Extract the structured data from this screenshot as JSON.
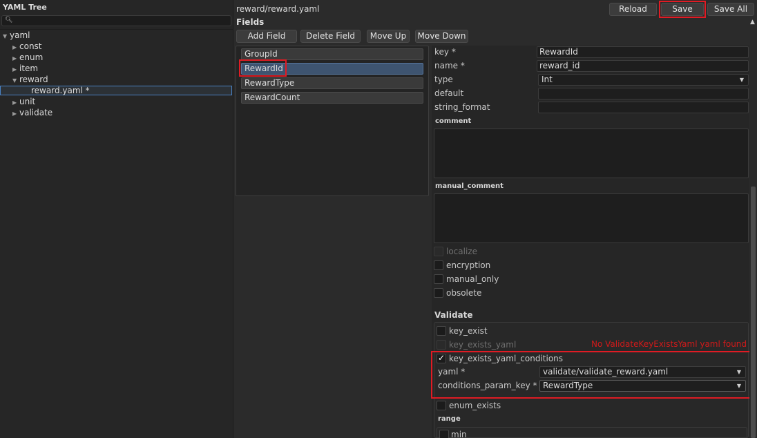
{
  "tree": {
    "title": "YAML Tree",
    "search_placeholder": "",
    "items": [
      {
        "label": "yaml",
        "expanded": true
      },
      {
        "label": "const",
        "expanded": false
      },
      {
        "label": "enum",
        "expanded": false
      },
      {
        "label": "item",
        "expanded": false
      },
      {
        "label": "reward",
        "expanded": true
      },
      {
        "label": "reward.yaml *",
        "selected": true
      },
      {
        "label": "unit",
        "expanded": false
      },
      {
        "label": "validate",
        "expanded": false
      }
    ]
  },
  "header": {
    "file_path": "reward/reward.yaml",
    "reload_label": "Reload",
    "save_label": "Save",
    "save_all_label": "Save All"
  },
  "fields": {
    "title": "Fields",
    "toolbar": {
      "add_label": "Add Field",
      "delete_label": "Delete Field",
      "move_up_label": "Move Up",
      "move_down_label": "Move Down"
    },
    "list": [
      "GroupId",
      "RewardId",
      "RewardType",
      "RewardCount"
    ],
    "selected": "RewardId"
  },
  "detail": {
    "key_label": "key *",
    "key_value": "RewardId",
    "name_label": "name *",
    "name_value": "reward_id",
    "type_label": "type",
    "type_value": "Int",
    "default_label": "default",
    "default_value": "",
    "string_format_label": "string_format",
    "string_format_value": "",
    "comment_label": "comment",
    "manual_comment_label": "manual_comment",
    "checkboxes": {
      "localize": {
        "label": "localize",
        "checked": false,
        "enabled": false
      },
      "encryption": {
        "label": "encryption",
        "checked": false
      },
      "manual_only": {
        "label": "manual_only",
        "checked": false
      },
      "obsolete": {
        "label": "obsolete",
        "checked": false
      }
    }
  },
  "validate": {
    "title": "Validate",
    "key_exist_label": "key_exist",
    "key_exists_yaml_label": "key_exists_yaml",
    "error_text": "No ValidateKeyExistsYaml yaml found",
    "conditions_label": "key_exists_yaml_conditions",
    "conditions_checked": true,
    "yaml_label": "yaml *",
    "yaml_value": "validate/validate_reward.yaml",
    "param_key_label": "conditions_param_key *",
    "param_key_value": "RewardType",
    "enum_exists_label": "enum_exists",
    "range_label": "range",
    "min_label": "min"
  },
  "colors": {
    "highlight": "#e01b24",
    "selection": "#3e5470",
    "error": "#d11a1a"
  },
  "icons": [
    "search-icon",
    "tree-expand-arrow-icon",
    "tree-collapse-arrow-icon",
    "dropdown-chevron-icon",
    "scroll-up-arrow-icon",
    "checkmark-icon"
  ]
}
